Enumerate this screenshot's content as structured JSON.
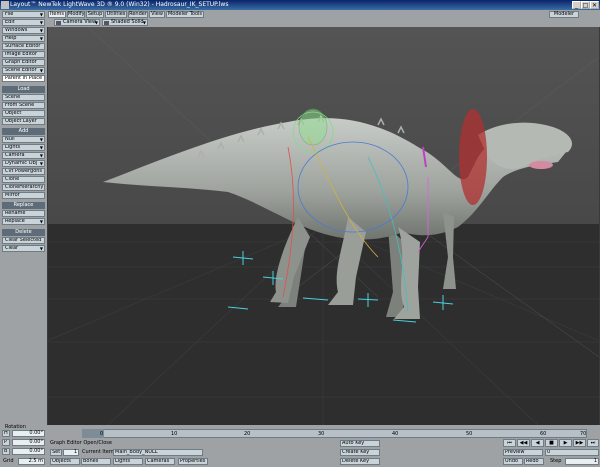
{
  "window": {
    "title": "Layout™ NewTek LightWave 3D ® 9.0 (Win32) - Hadrosaur_IK_SETUP.lws",
    "min": "_",
    "max": "□",
    "close": "✕"
  },
  "sidebar": {
    "top_buttons": [
      "File",
      "Edit",
      "Windows",
      "Help",
      "Surface Editor",
      "Image Editor",
      "Graph Editor",
      "Scene Editor"
    ],
    "parent_in_place": "Parent in Place",
    "load_header": "Load",
    "load_buttons": [
      "Scene",
      "From Scene",
      "Object",
      "Object Layer"
    ],
    "add_header": "Add",
    "add_buttons": [
      "Null",
      "Lights",
      "Camera",
      "Dynamic Obj",
      "Cvt Powergons",
      "Clone",
      "CloneHierarchy",
      "Mirror"
    ],
    "replace_header": "Replace",
    "replace_buttons": [
      "Rename",
      "Replace"
    ],
    "delete_header": "Delete",
    "delete_buttons": [
      "Clear Selected",
      "Clear"
    ]
  },
  "tabs": [
    "Items",
    "Modify",
    "Setup",
    "Utilities",
    "Render",
    "View",
    "Modeler Tools"
  ],
  "modeler_button": "Modeler",
  "viewport": {
    "camera_view": "Camera View",
    "shading_mode": "Shaded Solid"
  },
  "timeline": {
    "rotation_label": "Rotation",
    "ticks": [
      "0",
      "10",
      "20",
      "30",
      "40",
      "50",
      "60"
    ],
    "current_frame": "0",
    "end_frame": "70",
    "hpb": [
      {
        "axis": "H",
        "value": "0.00°"
      },
      {
        "axis": "P",
        "value": "0.00°"
      },
      {
        "axis": "B",
        "value": "0.00°"
      }
    ],
    "grid_label": "Grid",
    "grid_value": "2.5 m",
    "status": "Graph Editor Open/Close",
    "set_label": "Set",
    "set_value": "1",
    "current_item_label": "Current Item",
    "current_item": "Main_Body_NULL",
    "item_modes": [
      "Objects",
      "Bones",
      "Lights",
      "Cameras"
    ],
    "properties": "Properties",
    "auto_key": "Auto Key",
    "create_key": "Create Key",
    "delete_key": "Delete Key",
    "preview": "Preview",
    "undo": "Undo",
    "redo": "Redo",
    "step_label": "Step",
    "step_value": "1",
    "transport": [
      "⏮",
      "◀◀",
      "◀",
      "■",
      "▶",
      "▶▶",
      "⏭"
    ]
  },
  "colors": {
    "panel": "#9fa2a5",
    "button": "#c9d4da",
    "viewport": "#4b4b4b",
    "title": "#0a246a"
  }
}
